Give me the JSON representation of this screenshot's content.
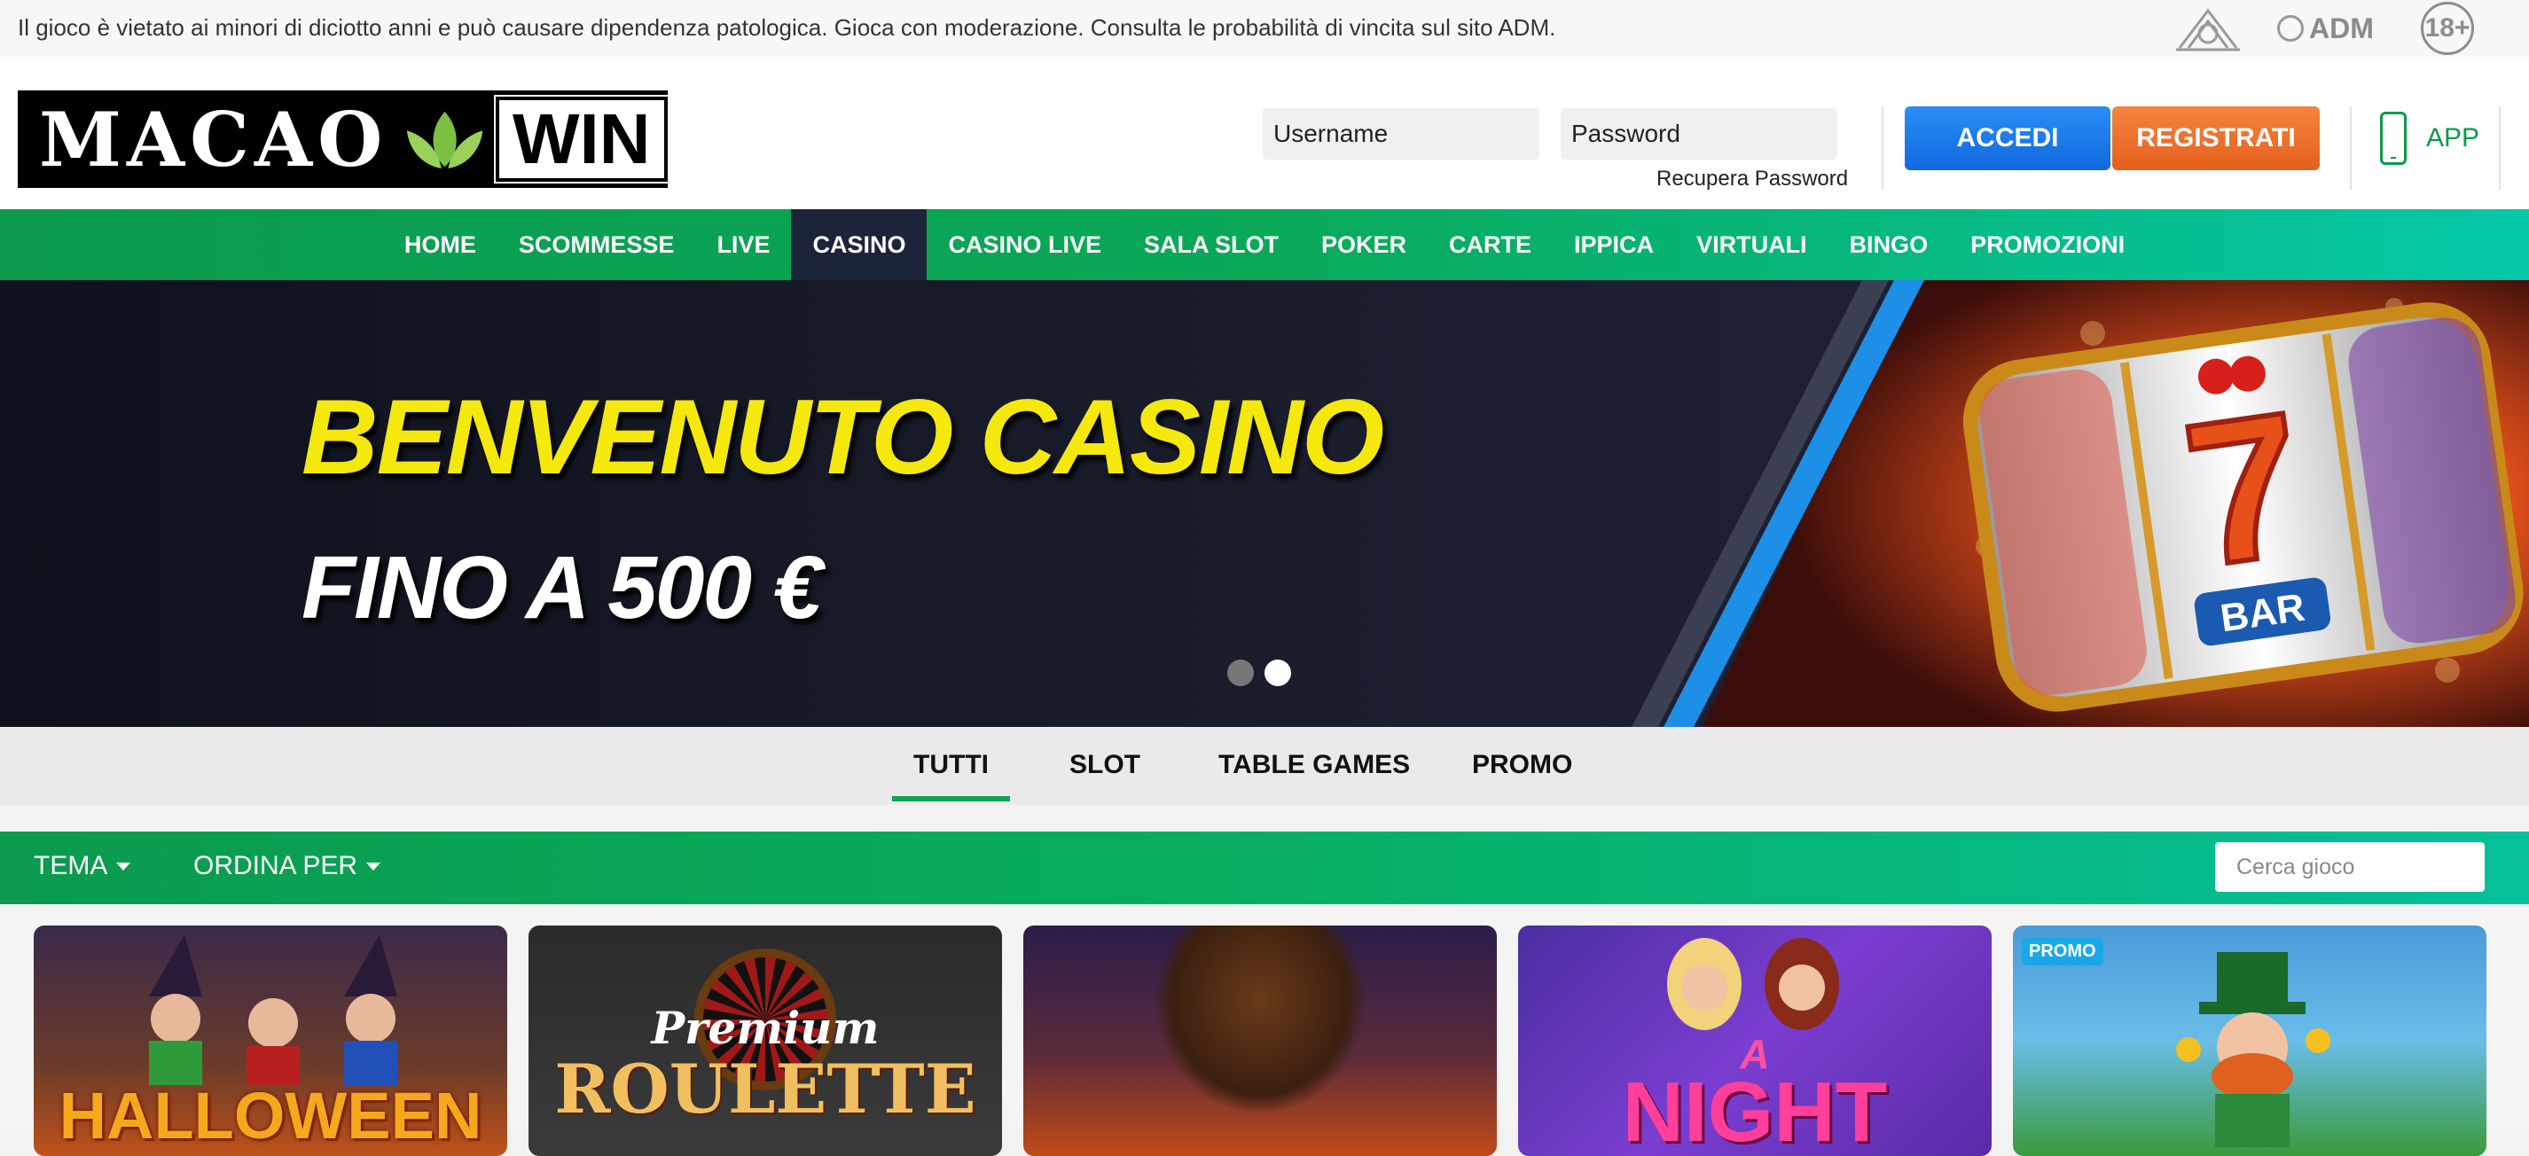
{
  "topbar": {
    "disclaimer": "Il gioco è vietato ai minori di diciotto anni e può causare dipendenza patologica. Gioca con moderazione. Consulta le probabilità di vincita sul sito ADM.",
    "adm_label": "ADM",
    "age_badge": "18+"
  },
  "header": {
    "logo": {
      "left": "MACAO",
      "right": "WIN"
    },
    "login": {
      "username_placeholder": "Username",
      "password_placeholder": "Password",
      "recover_label": "Recupera Password",
      "login_label": "ACCEDI",
      "register_label": "REGISTRATI"
    },
    "app_label": "APP"
  },
  "nav": {
    "items": [
      {
        "label": "HOME"
      },
      {
        "label": "SCOMMESSE"
      },
      {
        "label": "LIVE"
      },
      {
        "label": "CASINO",
        "active": true
      },
      {
        "label": "CASINO LIVE"
      },
      {
        "label": "SALA SLOT"
      },
      {
        "label": "POKER"
      },
      {
        "label": "CARTE"
      },
      {
        "label": "IPPICA"
      },
      {
        "label": "VIRTUALI"
      },
      {
        "label": "BINGO"
      },
      {
        "label": "PROMOZIONI"
      }
    ]
  },
  "hero": {
    "title": "BENVENUTO CASINO",
    "subtitle": "FINO A 500 €",
    "art_glyphs": {
      "seven": "7",
      "bar": "BAR"
    },
    "slides_total": 2,
    "active_slide": 2
  },
  "category_tabs": {
    "items": [
      {
        "label": "TUTTI",
        "active": true
      },
      {
        "label": "SLOT"
      },
      {
        "label": "TABLE GAMES"
      },
      {
        "label": "PROMO"
      }
    ]
  },
  "filters": {
    "theme_label": "TEMA",
    "sort_label": "ORDINA PER",
    "search_placeholder": "Cerca gioco"
  },
  "games": {
    "cards": [
      {
        "art_text": "HALLOWEEN"
      },
      {
        "art_text_top": "Premium",
        "art_text_main": "ROULETTE"
      },
      {
        "art_text": ""
      },
      {
        "art_text_top": "A",
        "art_text_main": "NIGHT"
      },
      {
        "badge": "PROMO"
      }
    ]
  },
  "colors": {
    "brand_green": "#0b9a4e",
    "nav_active": "#1b2438",
    "login_blue": "#1a7ce8",
    "register_orange": "#ee7230",
    "hero_yellow": "#f5e80c"
  }
}
